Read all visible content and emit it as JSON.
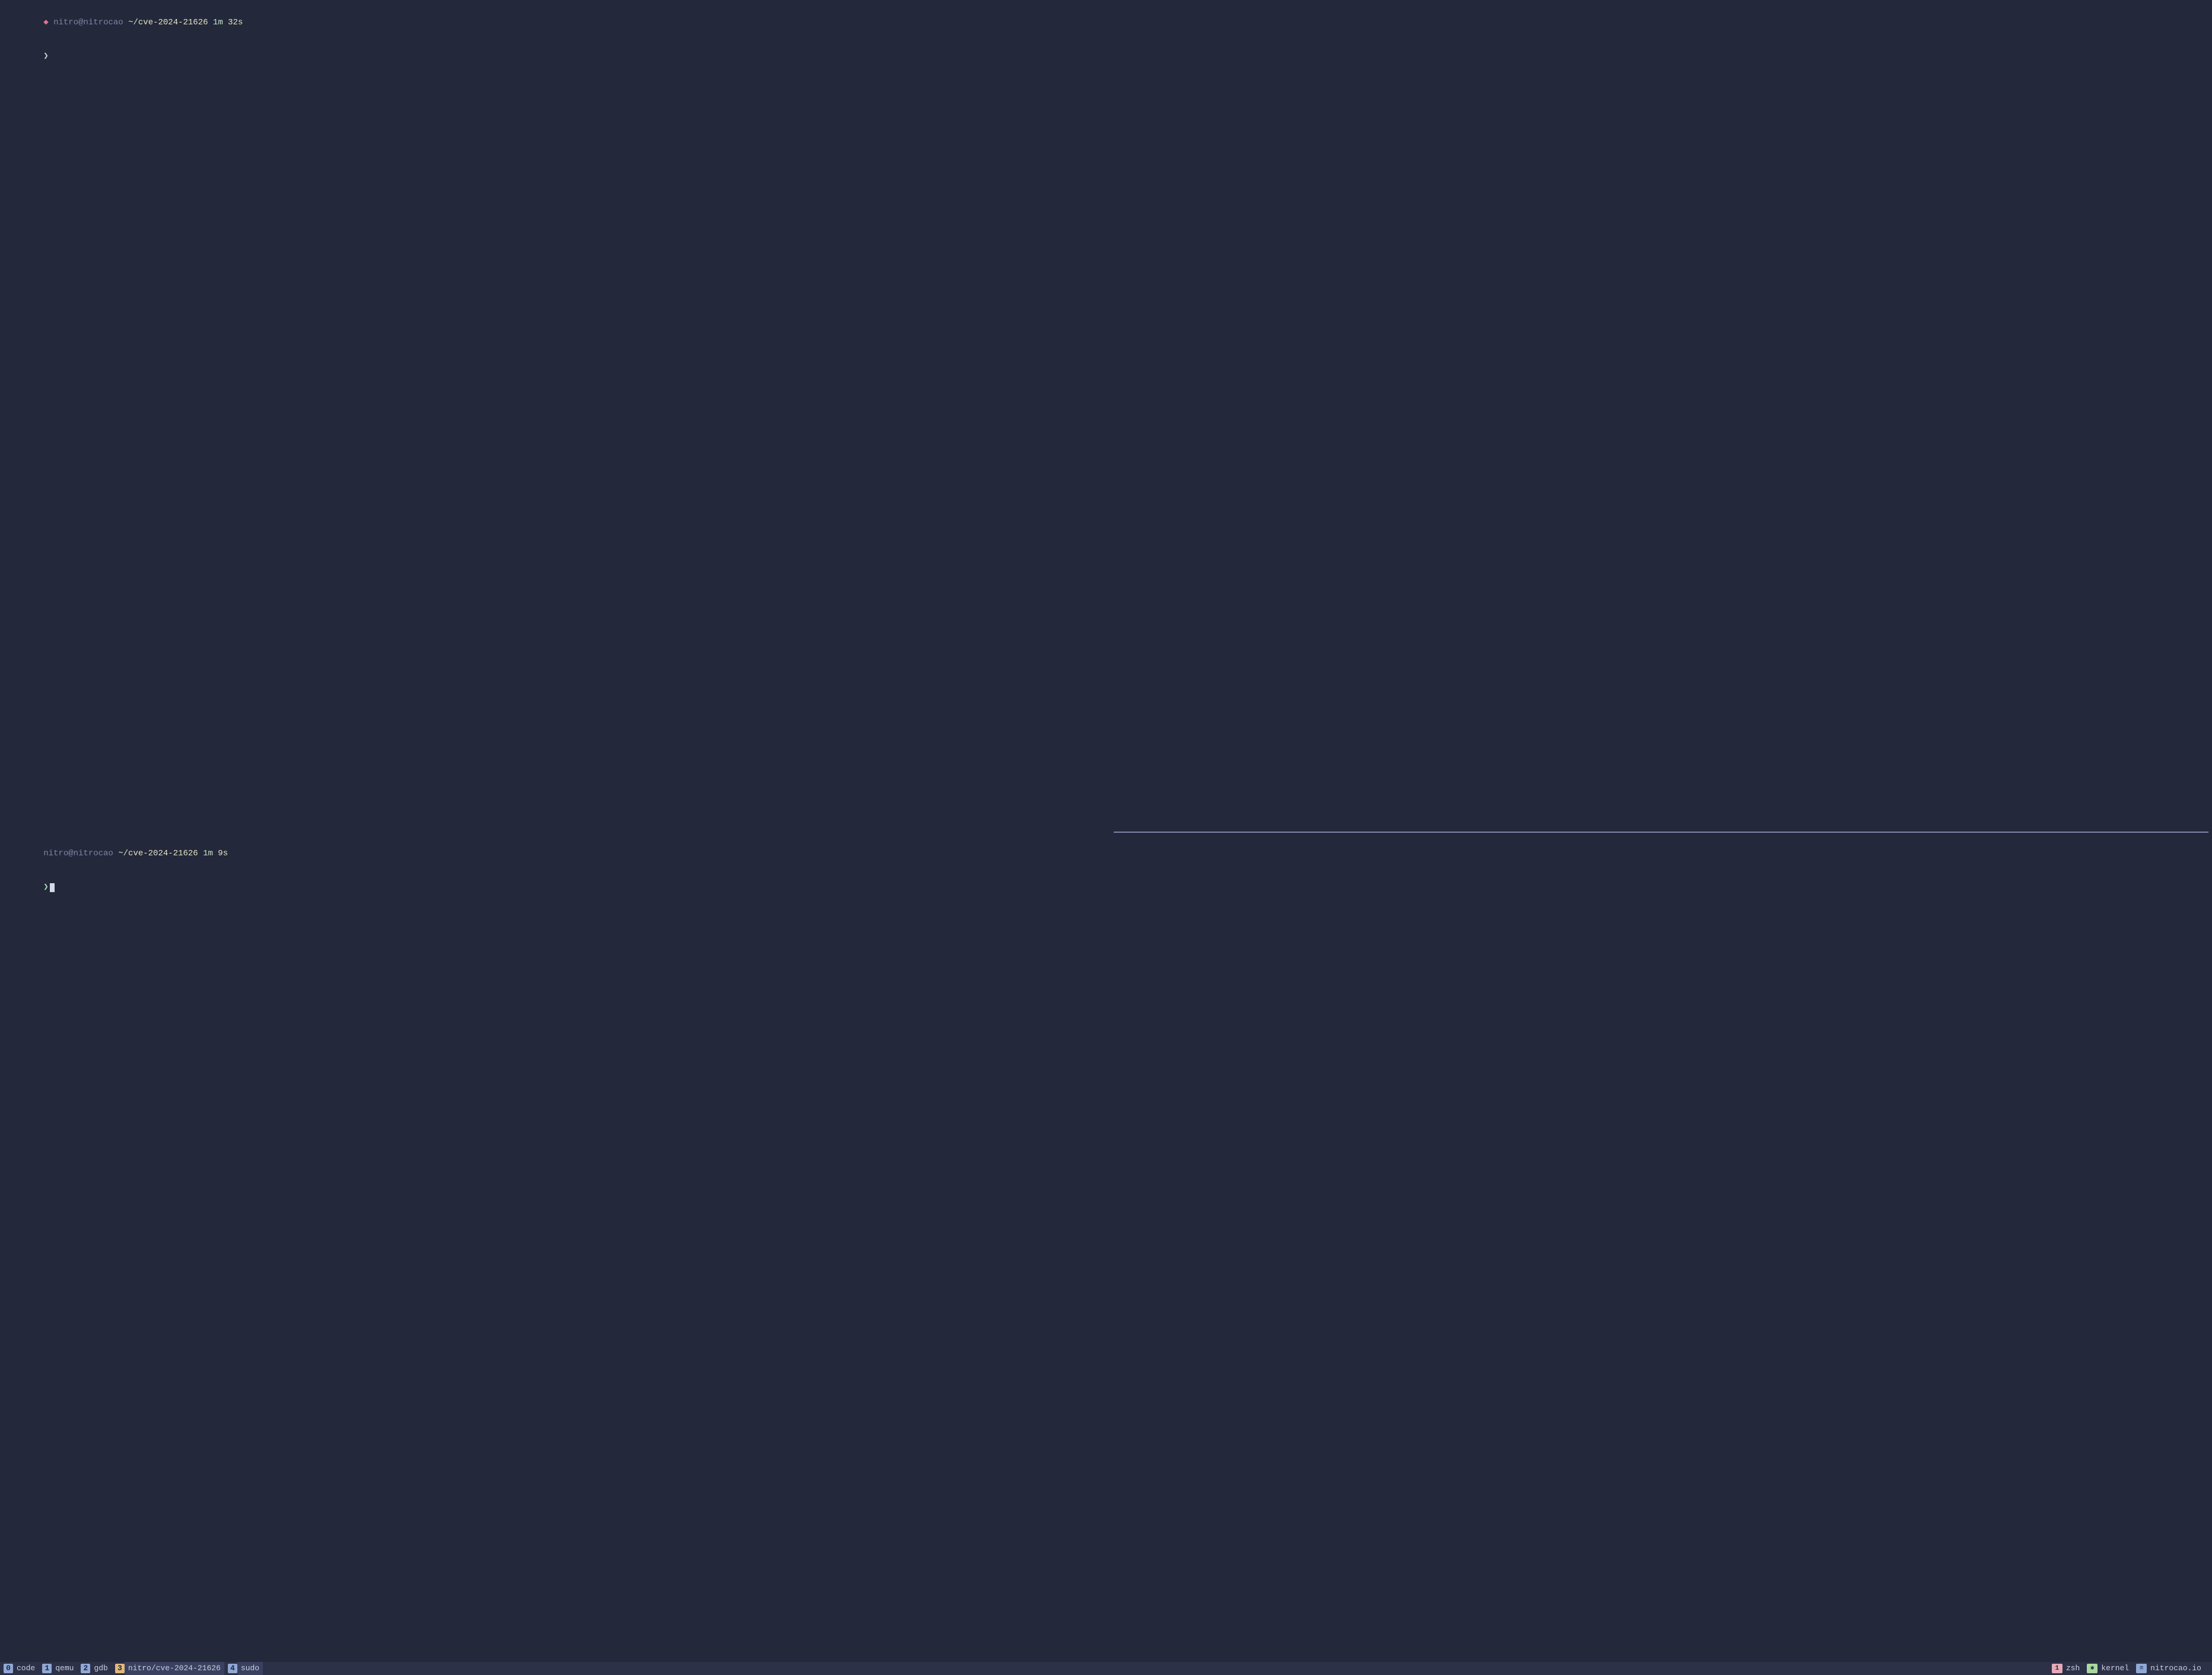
{
  "panes": {
    "top": {
      "indicator": "◆",
      "user_host": "nitro@nitrocao",
      "cwd": "~/cve-2024-21626",
      "duration_min": "1m",
      "duration_sec": "32s",
      "caret": "❯",
      "active": false
    },
    "bottom": {
      "indicator": "",
      "user_host": "nitro@nitrocao",
      "cwd": "~/cve-2024-21626",
      "duration_min": "1m",
      "duration_sec": "9s",
      "caret": "❯",
      "active": true
    }
  },
  "statusbar": {
    "left": [
      {
        "num": "0",
        "num_bg": "#8ea8d8",
        "label": "code",
        "active": false
      },
      {
        "num": "1",
        "num_bg": "#8ea8d8",
        "label": "qemu",
        "active": false
      },
      {
        "num": "2",
        "num_bg": "#8ea8d8",
        "label": "gdb",
        "active": false
      },
      {
        "num": "3",
        "num_bg": "#e2b97d",
        "label": "nitro/cve-2024-21626",
        "active": true
      },
      {
        "num": "4",
        "num_bg": "#8ea8d8",
        "label": "sudo",
        "active": true
      }
    ],
    "right": [
      {
        "icon": "1",
        "icon_bg": "#e6a9b6",
        "label": "zsh"
      },
      {
        "icon": "✱",
        "icon_bg": "#a7d9a1",
        "label": "kernel"
      },
      {
        "icon": "≡",
        "icon_bg": "#8ea8d8",
        "label": "nitrocao.io"
      }
    ]
  },
  "colors": {
    "bg": "#23283b",
    "statusbar_bg": "#2c3147",
    "text": "#c8d0e0"
  }
}
